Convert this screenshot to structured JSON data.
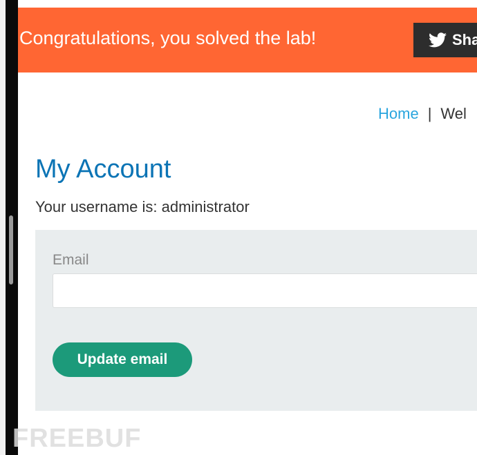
{
  "banner": {
    "message": "Congratulations, you solved the lab!",
    "share_label": "Sha",
    "share_icon": "twitter-bird-icon",
    "color": "#ff6633"
  },
  "nav": {
    "home_label": "Home",
    "separator": "|",
    "welcome_label": "Wel"
  },
  "page": {
    "title": "My Account",
    "username_line": "Your username is: administrator"
  },
  "form": {
    "email_label": "Email",
    "email_value": "",
    "update_button_label": "Update email",
    "button_color": "#1c9a7a"
  },
  "watermark": {
    "text": "FREEBUF"
  }
}
